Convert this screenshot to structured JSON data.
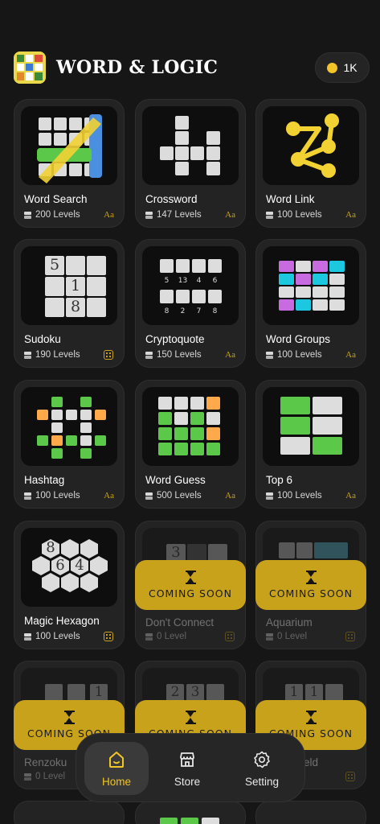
{
  "header": {
    "title": "WORD & LOGIC",
    "coins": "1K"
  },
  "games": [
    {
      "name": "Word Search",
      "levels": "200 Levels",
      "badge": "Aa"
    },
    {
      "name": "Crossword",
      "levels": "147 Levels",
      "badge": "Aa"
    },
    {
      "name": "Word Link",
      "levels": "100 Levels",
      "badge": "Aa"
    },
    {
      "name": "Sudoku",
      "levels": "190 Levels",
      "badge": "grid"
    },
    {
      "name": "Cryptoquote",
      "levels": "150 Levels",
      "badge": "Aa"
    },
    {
      "name": "Word Groups",
      "levels": "100 Levels",
      "badge": "Aa"
    },
    {
      "name": "Hashtag",
      "levels": "100 Levels",
      "badge": "Aa"
    },
    {
      "name": "Word Guess",
      "levels": "500 Levels",
      "badge": "Aa"
    },
    {
      "name": "Top 6",
      "levels": "100 Levels",
      "badge": "Aa"
    },
    {
      "name": "Magic Hexagon",
      "levels": "100 Levels",
      "badge": "grid"
    },
    {
      "name": "Don't Connect",
      "levels": "0 Level",
      "badge": "grid"
    },
    {
      "name": "Aquarium",
      "levels": "0 Level",
      "badge": "grid"
    },
    {
      "name": "Renzoku",
      "levels": "0 Level",
      "badge": "grid"
    },
    {
      "name": "",
      "levels": "",
      "badge": ""
    },
    {
      "name": "eld",
      "levels": "",
      "badge": "grid"
    }
  ],
  "thumbs": {
    "sudoku_nums": [
      "5",
      "1",
      "8"
    ],
    "hexagon_nums": [
      "8",
      "6",
      "4"
    ],
    "crypto_top": [
      "5",
      "13",
      "4",
      "6"
    ],
    "crypto_bottom": [
      "8",
      "2",
      "7",
      "8"
    ],
    "dont_connect_num": "3",
    "renzoku_num": "1",
    "row5b_nums": [
      "2",
      "3"
    ],
    "row5c_nums": [
      "1",
      "1"
    ]
  },
  "coming_soon": {
    "label": "COMING SOON"
  },
  "nav": {
    "home": "Home",
    "store": "Store",
    "setting": "Setting"
  },
  "colors": {
    "accent": "#f3c526",
    "soon_bg": "#c9a21c",
    "bg": "#161616",
    "card": "#232323"
  }
}
